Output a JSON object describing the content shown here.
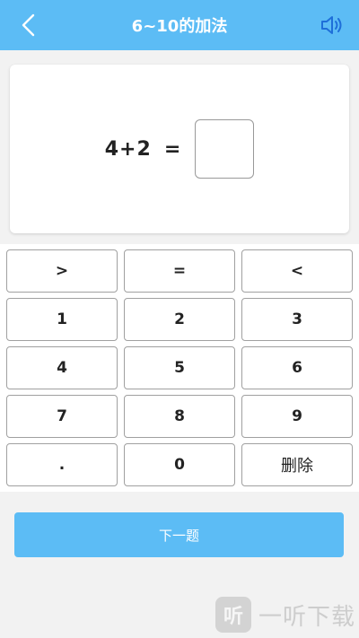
{
  "header": {
    "title": "6~10的加法",
    "back_icon": "chevron-left-icon",
    "speaker_icon": "speaker-icon",
    "bg_color": "#5cbcf5"
  },
  "question": {
    "expression": "4+2",
    "equals": "=",
    "answer_value": ""
  },
  "keypad": {
    "keys": [
      ">",
      "=",
      "<",
      "1",
      "2",
      "3",
      "4",
      "5",
      "6",
      "7",
      "8",
      "9",
      ".",
      "0",
      "删除"
    ]
  },
  "next_button": {
    "label": "下一题"
  },
  "watermark": {
    "logo_text": "听",
    "text": "一听下载"
  }
}
